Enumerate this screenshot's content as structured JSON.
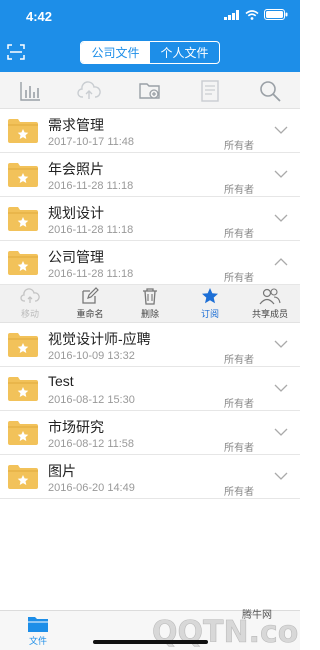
{
  "status": {
    "time": "4:42"
  },
  "segment": {
    "tabs": [
      "公司文件",
      "个人文件"
    ],
    "active": 0
  },
  "toolbar": {
    "icons": [
      "sort-stats-icon",
      "cloud-upload-icon",
      "new-folder-icon",
      "document-icon",
      "search-icon"
    ]
  },
  "files": [
    {
      "name": "需求管理",
      "date": "2017-10-17 11:48",
      "owner": "所有者",
      "expanded": false
    },
    {
      "name": "年会照片",
      "date": "2016-11-28 11:18",
      "owner": "所有者",
      "expanded": false
    },
    {
      "name": "规划设计",
      "date": "2016-11-28 11:18",
      "owner": "所有者",
      "expanded": false
    },
    {
      "name": "公司管理",
      "date": "2016-11-28 11:18",
      "owner": "所有者",
      "expanded": true
    },
    {
      "name": "视觉设计师-应聘",
      "date": "2016-10-09 13:32",
      "owner": "所有者",
      "expanded": false
    },
    {
      "name": "Test",
      "date": "2016-08-12 15:30",
      "owner": "所有者",
      "expanded": false
    },
    {
      "name": "市场研究",
      "date": "2016-08-12 11:58",
      "owner": "所有者",
      "expanded": false
    },
    {
      "name": "图片",
      "date": "2016-06-20 14:49",
      "owner": "所有者",
      "expanded": false
    }
  ],
  "actions": [
    {
      "label": "移动",
      "state": "disabled"
    },
    {
      "label": "重命名",
      "state": "normal"
    },
    {
      "label": "删除",
      "state": "normal"
    },
    {
      "label": "订阅",
      "state": "active"
    },
    {
      "label": "共享成员",
      "state": "normal"
    }
  ],
  "tabbar": {
    "files_label": "文件"
  },
  "watermark": {
    "site": "腾牛网",
    "brand": "QQTN.com"
  },
  "colors": {
    "primary": "#1d8ee8",
    "folder": "#f2c25a",
    "star": "#ffffff"
  }
}
